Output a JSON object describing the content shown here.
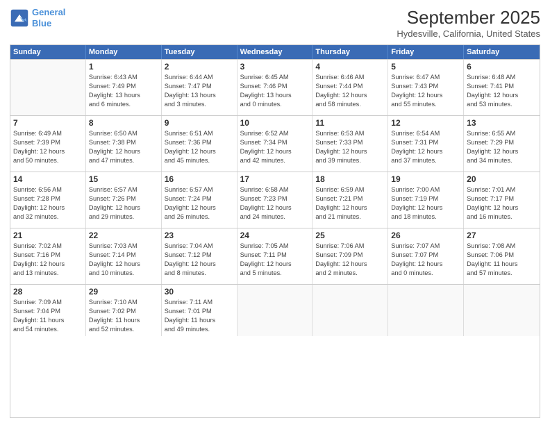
{
  "header": {
    "logo_line1": "General",
    "logo_line2": "Blue",
    "title": "September 2025",
    "subtitle": "Hydesville, California, United States"
  },
  "weekdays": [
    "Sunday",
    "Monday",
    "Tuesday",
    "Wednesday",
    "Thursday",
    "Friday",
    "Saturday"
  ],
  "rows": [
    [
      {
        "day": "",
        "info": ""
      },
      {
        "day": "1",
        "info": "Sunrise: 6:43 AM\nSunset: 7:49 PM\nDaylight: 13 hours\nand 6 minutes."
      },
      {
        "day": "2",
        "info": "Sunrise: 6:44 AM\nSunset: 7:47 PM\nDaylight: 13 hours\nand 3 minutes."
      },
      {
        "day": "3",
        "info": "Sunrise: 6:45 AM\nSunset: 7:46 PM\nDaylight: 13 hours\nand 0 minutes."
      },
      {
        "day": "4",
        "info": "Sunrise: 6:46 AM\nSunset: 7:44 PM\nDaylight: 12 hours\nand 58 minutes."
      },
      {
        "day": "5",
        "info": "Sunrise: 6:47 AM\nSunset: 7:43 PM\nDaylight: 12 hours\nand 55 minutes."
      },
      {
        "day": "6",
        "info": "Sunrise: 6:48 AM\nSunset: 7:41 PM\nDaylight: 12 hours\nand 53 minutes."
      }
    ],
    [
      {
        "day": "7",
        "info": "Sunrise: 6:49 AM\nSunset: 7:39 PM\nDaylight: 12 hours\nand 50 minutes."
      },
      {
        "day": "8",
        "info": "Sunrise: 6:50 AM\nSunset: 7:38 PM\nDaylight: 12 hours\nand 47 minutes."
      },
      {
        "day": "9",
        "info": "Sunrise: 6:51 AM\nSunset: 7:36 PM\nDaylight: 12 hours\nand 45 minutes."
      },
      {
        "day": "10",
        "info": "Sunrise: 6:52 AM\nSunset: 7:34 PM\nDaylight: 12 hours\nand 42 minutes."
      },
      {
        "day": "11",
        "info": "Sunrise: 6:53 AM\nSunset: 7:33 PM\nDaylight: 12 hours\nand 39 minutes."
      },
      {
        "day": "12",
        "info": "Sunrise: 6:54 AM\nSunset: 7:31 PM\nDaylight: 12 hours\nand 37 minutes."
      },
      {
        "day": "13",
        "info": "Sunrise: 6:55 AM\nSunset: 7:29 PM\nDaylight: 12 hours\nand 34 minutes."
      }
    ],
    [
      {
        "day": "14",
        "info": "Sunrise: 6:56 AM\nSunset: 7:28 PM\nDaylight: 12 hours\nand 32 minutes."
      },
      {
        "day": "15",
        "info": "Sunrise: 6:57 AM\nSunset: 7:26 PM\nDaylight: 12 hours\nand 29 minutes."
      },
      {
        "day": "16",
        "info": "Sunrise: 6:57 AM\nSunset: 7:24 PM\nDaylight: 12 hours\nand 26 minutes."
      },
      {
        "day": "17",
        "info": "Sunrise: 6:58 AM\nSunset: 7:23 PM\nDaylight: 12 hours\nand 24 minutes."
      },
      {
        "day": "18",
        "info": "Sunrise: 6:59 AM\nSunset: 7:21 PM\nDaylight: 12 hours\nand 21 minutes."
      },
      {
        "day": "19",
        "info": "Sunrise: 7:00 AM\nSunset: 7:19 PM\nDaylight: 12 hours\nand 18 minutes."
      },
      {
        "day": "20",
        "info": "Sunrise: 7:01 AM\nSunset: 7:17 PM\nDaylight: 12 hours\nand 16 minutes."
      }
    ],
    [
      {
        "day": "21",
        "info": "Sunrise: 7:02 AM\nSunset: 7:16 PM\nDaylight: 12 hours\nand 13 minutes."
      },
      {
        "day": "22",
        "info": "Sunrise: 7:03 AM\nSunset: 7:14 PM\nDaylight: 12 hours\nand 10 minutes."
      },
      {
        "day": "23",
        "info": "Sunrise: 7:04 AM\nSunset: 7:12 PM\nDaylight: 12 hours\nand 8 minutes."
      },
      {
        "day": "24",
        "info": "Sunrise: 7:05 AM\nSunset: 7:11 PM\nDaylight: 12 hours\nand 5 minutes."
      },
      {
        "day": "25",
        "info": "Sunrise: 7:06 AM\nSunset: 7:09 PM\nDaylight: 12 hours\nand 2 minutes."
      },
      {
        "day": "26",
        "info": "Sunrise: 7:07 AM\nSunset: 7:07 PM\nDaylight: 12 hours\nand 0 minutes."
      },
      {
        "day": "27",
        "info": "Sunrise: 7:08 AM\nSunset: 7:06 PM\nDaylight: 11 hours\nand 57 minutes."
      }
    ],
    [
      {
        "day": "28",
        "info": "Sunrise: 7:09 AM\nSunset: 7:04 PM\nDaylight: 11 hours\nand 54 minutes."
      },
      {
        "day": "29",
        "info": "Sunrise: 7:10 AM\nSunset: 7:02 PM\nDaylight: 11 hours\nand 52 minutes."
      },
      {
        "day": "30",
        "info": "Sunrise: 7:11 AM\nSunset: 7:01 PM\nDaylight: 11 hours\nand 49 minutes."
      },
      {
        "day": "",
        "info": ""
      },
      {
        "day": "",
        "info": ""
      },
      {
        "day": "",
        "info": ""
      },
      {
        "day": "",
        "info": ""
      }
    ]
  ]
}
